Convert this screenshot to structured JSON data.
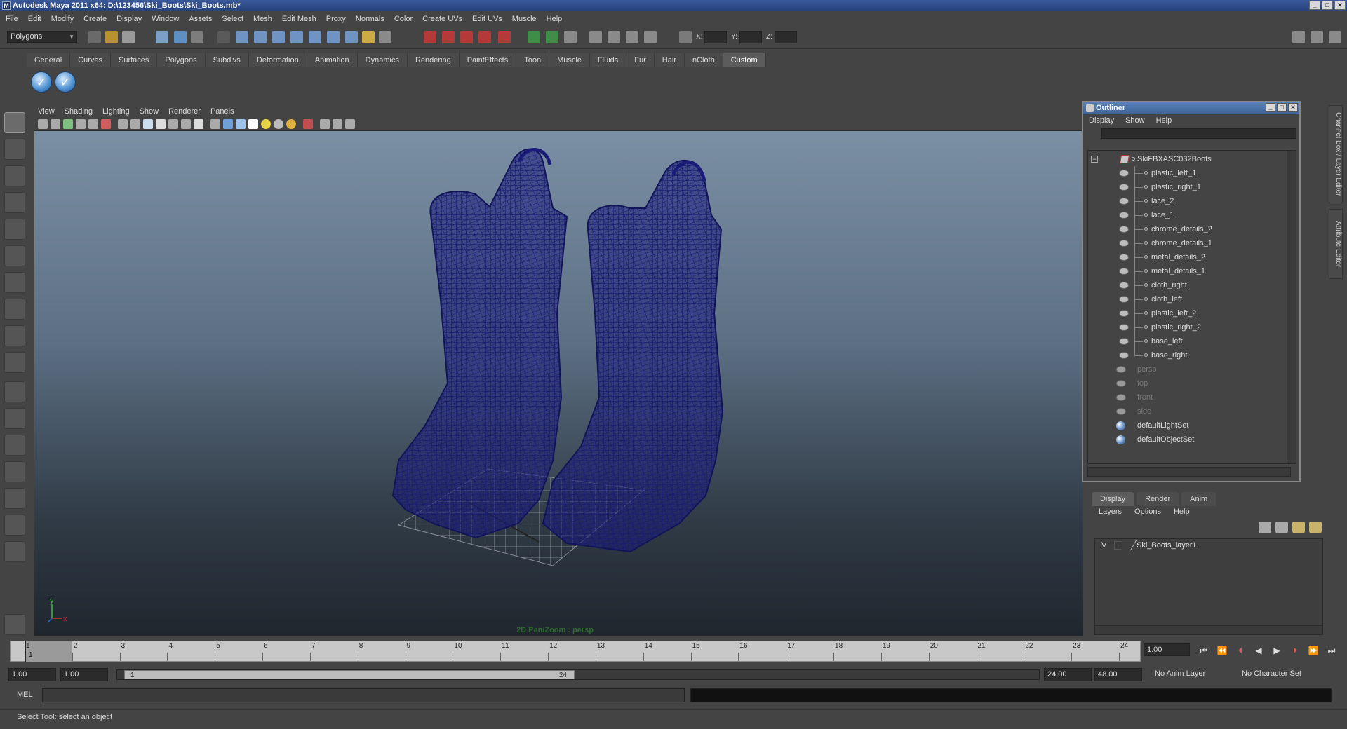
{
  "window": {
    "title": "Autodesk Maya 2011 x64: D:\\123456\\Ski_Boots\\Ski_Boots.mb*",
    "controls": [
      "_",
      "□",
      "✕"
    ]
  },
  "menubar": [
    "File",
    "Edit",
    "Modify",
    "Create",
    "Display",
    "Window",
    "Assets",
    "Select",
    "Mesh",
    "Edit Mesh",
    "Proxy",
    "Normals",
    "Color",
    "Create UVs",
    "Edit UVs",
    "Muscle",
    "Help"
  ],
  "status_line": {
    "mode": "Polygons",
    "coords": {
      "x_label": "X:",
      "y_label": "Y:",
      "z_label": "Z:"
    }
  },
  "shelf": {
    "tabs": [
      "General",
      "Curves",
      "Surfaces",
      "Polygons",
      "Subdivs",
      "Deformation",
      "Animation",
      "Dynamics",
      "Rendering",
      "PaintEffects",
      "Toon",
      "Muscle",
      "Fluids",
      "Fur",
      "Hair",
      "nCloth",
      "Custom"
    ],
    "active_tab": "Custom",
    "buttons": [
      "check-icon",
      "check-icon"
    ]
  },
  "viewport": {
    "menu": [
      "View",
      "Shading",
      "Lighting",
      "Show",
      "Renderer",
      "Panels"
    ],
    "camera_label": "2D Pan/Zoom : persp",
    "axis": {
      "y": "y",
      "x": "x"
    },
    "wire_color": "#1a1c78"
  },
  "outliner": {
    "title": "Outliner",
    "menu": [
      "Display",
      "Show",
      "Help"
    ],
    "root": "SkiFBXASC032Boots",
    "children": [
      "plastic_left_1",
      "plastic_right_1",
      "lace_2",
      "lace_1",
      "chrome_details_2",
      "chrome_details_1",
      "metal_details_2",
      "metal_details_1",
      "cloth_right",
      "cloth_left",
      "plastic_left_2",
      "plastic_right_2",
      "base_left",
      "base_right"
    ],
    "cameras": [
      "persp",
      "top",
      "front",
      "side"
    ],
    "sets": [
      "defaultLightSet",
      "defaultObjectSet"
    ]
  },
  "side_tabs": [
    "Channel Box / Layer Editor",
    "Attribute Editor"
  ],
  "layer_editor": {
    "tabs": [
      "Display",
      "Render",
      "Anim"
    ],
    "active_tab": "Display",
    "menu": [
      "Layers",
      "Options",
      "Help"
    ],
    "layers": [
      {
        "visible": "V",
        "name": "Ski_Boots_layer1"
      }
    ]
  },
  "time_slider": {
    "ticks": [
      "1",
      "2",
      "3",
      "4",
      "5",
      "6",
      "7",
      "8",
      "9",
      "10",
      "11",
      "12",
      "13",
      "14",
      "15",
      "16",
      "17",
      "18",
      "19",
      "20",
      "21",
      "22",
      "23",
      "24"
    ],
    "current_frame": "1",
    "current_time_field": "1.00"
  },
  "range_slider": {
    "start": "1.00",
    "playback_start": "1.00",
    "thumb_start": "1",
    "thumb_end": "24",
    "playback_end": "24.00",
    "end": "48.00",
    "anim_layer": "No Anim Layer",
    "character_set": "No Character Set"
  },
  "command_line": {
    "label": "MEL"
  },
  "help_line": "Select Tool: select an object"
}
